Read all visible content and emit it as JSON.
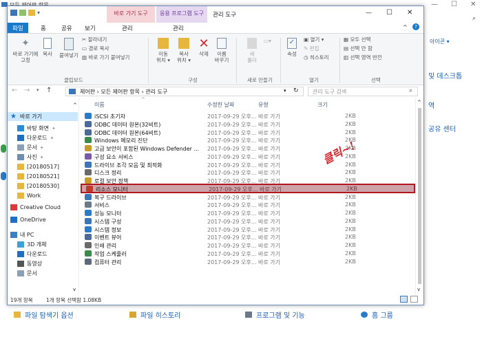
{
  "bg": {
    "title": "모든 제어판 항목",
    "links": [
      "아이콘 ▾",
      "및 데스크톱",
      "역",
      "공유 센터"
    ],
    "bottom": [
      "파일 탐색기 옵션",
      "파일 히스토리",
      "프로그램 및 기능",
      "홈 그룹"
    ]
  },
  "window": {
    "tools_tab": "바로 가기 도구",
    "app_tools_tab": "응용 프로그램 도구",
    "title": "관리 도구",
    "min": "—",
    "max": "☐",
    "close": "✕"
  },
  "tabs": {
    "file": "파일",
    "home": "홈",
    "share": "공유",
    "view": "보기",
    "manage1": "관리",
    "manage2": "관리"
  },
  "ribbon": {
    "pin": "바로 가기에\n고정",
    "copy": "복사",
    "paste": "붙여넣기",
    "cut": "잘라내기",
    "copy_path": "경로 복사",
    "paste_shortcut": "바로 가기 붙여넣기",
    "clipboard": "클립보드",
    "move": "이동\n위치 ▾",
    "copy_to": "복사\n위치 ▾",
    "delete": "삭제",
    "rename": "이름\n바꾸기",
    "organize": "구성",
    "new_folder": "새\n폴더",
    "new": "새로 만들기",
    "props": "속성",
    "open": "열기 ▾",
    "edit": "편집",
    "history": "히스토리",
    "open_grp": "열기",
    "select_all": "모두 선택",
    "select_none": "선택 안 함",
    "invert": "선택 영역 반전",
    "select": "선택"
  },
  "address": {
    "path": "제어판  ›  모든 제어판 항목  ›  관리 도구",
    "search_placeholder": "관리 도구 검색"
  },
  "nav": [
    {
      "label": "바로 가기",
      "icon": "star-icon",
      "color": "#1a73c8"
    },
    {
      "label": "바탕 화면",
      "icon": "desktop-icon",
      "color": "#2a8bd8"
    },
    {
      "label": "다운로드",
      "icon": "download-icon",
      "color": "#1c6fc4"
    },
    {
      "label": "문서",
      "icon": "document-icon",
      "color": "#8aa0b8"
    },
    {
      "label": "사진",
      "icon": "picture-icon",
      "color": "#6f8fb0"
    },
    {
      "label": "[20180517]",
      "icon": "folder-icon",
      "color": "#e6b63d"
    },
    {
      "label": "[20180521]",
      "icon": "folder-icon",
      "color": "#e6b63d"
    },
    {
      "label": "[20180530]",
      "icon": "folder-icon",
      "color": "#e6b63d"
    },
    {
      "label": "Work",
      "icon": "folder-icon",
      "color": "#e6b63d"
    },
    {
      "label": "Creative Cloud",
      "icon": "creative-cloud-icon",
      "color": "#da3b3b"
    },
    {
      "label": "OneDrive",
      "icon": "onedrive-icon",
      "color": "#1e6fc8"
    },
    {
      "label": "내 PC",
      "icon": "pc-icon",
      "color": "#3b7fc4"
    },
    {
      "label": "3D 개체",
      "icon": "3d-objects-icon",
      "color": "#3ea0d8"
    },
    {
      "label": "다운로드",
      "icon": "download-icon",
      "color": "#1c6fc4"
    },
    {
      "label": "동영상",
      "icon": "video-icon",
      "color": "#555"
    },
    {
      "label": "문서",
      "icon": "document-icon",
      "color": "#8aa0b8"
    }
  ],
  "columns": {
    "name": "이름",
    "date": "수정한 날짜",
    "type": "유형",
    "size": "크기"
  },
  "rows": [
    {
      "name": "iSCSI 초기자",
      "date": "2017-09-29 오후...",
      "type": "바로 가기",
      "size": "2KB",
      "color": "#2b7bc6"
    },
    {
      "name": "ODBC 데이터 원본(32비트)",
      "date": "2017-09-29 오후...",
      "type": "바로 가기",
      "size": "2KB",
      "color": "#4b6a9a"
    },
    {
      "name": "ODBC 데이터 원본(64비트)",
      "date": "2017-09-29 오후...",
      "type": "바로 가기",
      "size": "2KB",
      "color": "#4b6a9a"
    },
    {
      "name": "Windows 메모리 진단",
      "date": "2017-09-29 오후...",
      "type": "바로 가기",
      "size": "2KB",
      "color": "#3a8a4a"
    },
    {
      "name": "고급 보안이 포함된 Windows Defender ...",
      "date": "2017-09-29 오후...",
      "type": "바로 가기",
      "size": "2KB",
      "color": "#c89a2a"
    },
    {
      "name": "구성 요소 서비스",
      "date": "2017-09-29 오후...",
      "type": "바로 가기",
      "size": "2KB",
      "color": "#7a5aa8"
    },
    {
      "name": "드라이브 조각 모음 및 최적화",
      "date": "2017-09-29 오후...",
      "type": "바로 가기",
      "size": "2KB",
      "color": "#3a76b8"
    },
    {
      "name": "디스크 정리",
      "date": "2017-09-29 오후...",
      "type": "바로 가기",
      "size": "2KB",
      "color": "#6a6a6a"
    },
    {
      "name": "로컬 보안 정책",
      "date": "2017-09-29 오후...",
      "type": "바로 가기",
      "size": "2KB",
      "color": "#c89a2a"
    },
    {
      "name": "리소스 모니터",
      "date": "2017-09-29 오후...",
      "type": "바로 가기",
      "size": "2KB",
      "color": "#c0392b",
      "selected": true
    },
    {
      "name": "복구 드라이브",
      "date": "2017-09-29 오후...",
      "type": "바로 가기",
      "size": "2KB",
      "color": "#3a76b8"
    },
    {
      "name": "서비스",
      "date": "2017-09-29 오후...",
      "type": "바로 가기",
      "size": "2KB",
      "color": "#6a7a8a"
    },
    {
      "name": "성능 모니터",
      "date": "2017-09-29 오후...",
      "type": "바로 가기",
      "size": "2KB",
      "color": "#2b7bc6"
    },
    {
      "name": "시스템 구성",
      "date": "2017-09-29 오후...",
      "type": "바로 가기",
      "size": "2KB",
      "color": "#3a76b8"
    },
    {
      "name": "시스템 정보",
      "date": "2017-09-29 오후...",
      "type": "바로 가기",
      "size": "2KB",
      "color": "#2b7bc6"
    },
    {
      "name": "이벤트 뷰어",
      "date": "2017-09-29 오후...",
      "type": "바로 가기",
      "size": "2KB",
      "color": "#4b6a9a"
    },
    {
      "name": "인쇄 관리",
      "date": "2017-09-29 오후...",
      "type": "바로 가기",
      "size": "2KB",
      "color": "#6a6a6a"
    },
    {
      "name": "작업 스케줄러",
      "date": "2017-09-29 오후...",
      "type": "바로 가기",
      "size": "2KB",
      "color": "#3a8a4a"
    },
    {
      "name": "컴퓨터 관리",
      "date": "2017-09-29 오후...",
      "type": "바로 가기",
      "size": "2KB",
      "color": "#5a6a7a"
    }
  ],
  "status": {
    "count": "19개 항목",
    "selected": "1개 항목 선택함 1.08KB"
  },
  "annotation": "클릭~!"
}
